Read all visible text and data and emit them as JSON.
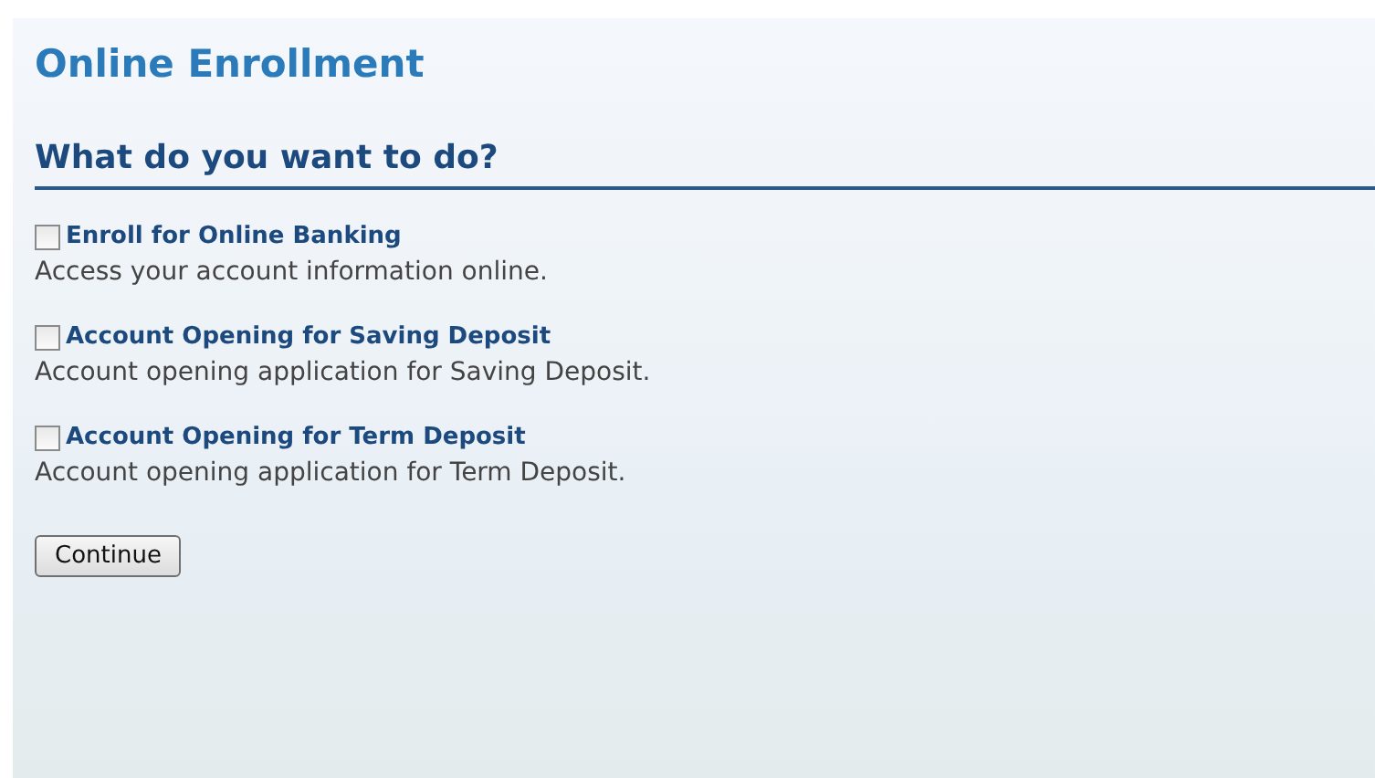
{
  "title": "Online Enrollment",
  "section_heading": "What do you want to do?",
  "options": [
    {
      "label": "Enroll for Online Banking",
      "description": "Access your account information online.",
      "checked": false
    },
    {
      "label": "Account Opening for Saving Deposit",
      "description": "Account opening application for Saving Deposit.",
      "checked": false
    },
    {
      "label": "Account Opening for Term Deposit",
      "description": "Account opening application for Term Deposit.",
      "checked": false
    }
  ],
  "buttons": [
    "Continue"
  ]
}
